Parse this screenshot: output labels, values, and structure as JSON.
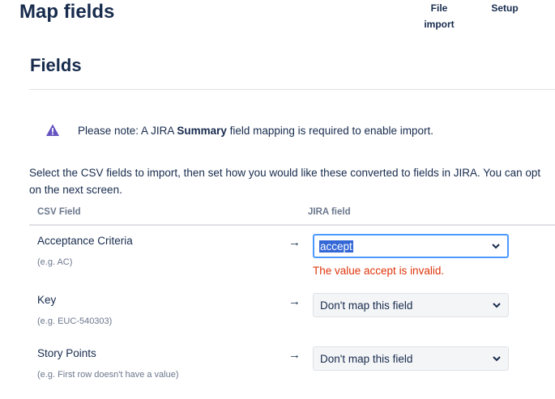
{
  "header": {
    "title": "Map fields",
    "nav": [
      {
        "line1": "File",
        "line2": "import"
      },
      {
        "line1": "Setup"
      }
    ]
  },
  "section": {
    "title": "Fields"
  },
  "note": {
    "prefix": "Please note: A JIRA ",
    "bold": "Summary",
    "suffix": " field mapping is required to enable import.",
    "icon": "warning-triangle-icon",
    "icon_color": "#6554c0"
  },
  "intro": {
    "line1": "Select the CSV fields to import, then set how you would like these converted to fields in JIRA. You can opt",
    "line2": "on the next screen."
  },
  "table": {
    "headers": {
      "csv": "CSV Field",
      "jira": "JIRA field"
    },
    "rows": [
      {
        "name": "Acceptance Criteria",
        "example": "(e.g. AC)",
        "selected": "accept",
        "error": "The value accept is invalid."
      },
      {
        "name": "Key",
        "example": "(e.g. EUC-540303)",
        "selected": "Don't map this field"
      },
      {
        "name": "Story Points",
        "example": "(e.g. First row doesn't have a value)",
        "selected": "Don't map this field"
      }
    ]
  },
  "colors": {
    "error": "#de350b",
    "focus": "#4c9aff",
    "selection": "#3367d6"
  }
}
